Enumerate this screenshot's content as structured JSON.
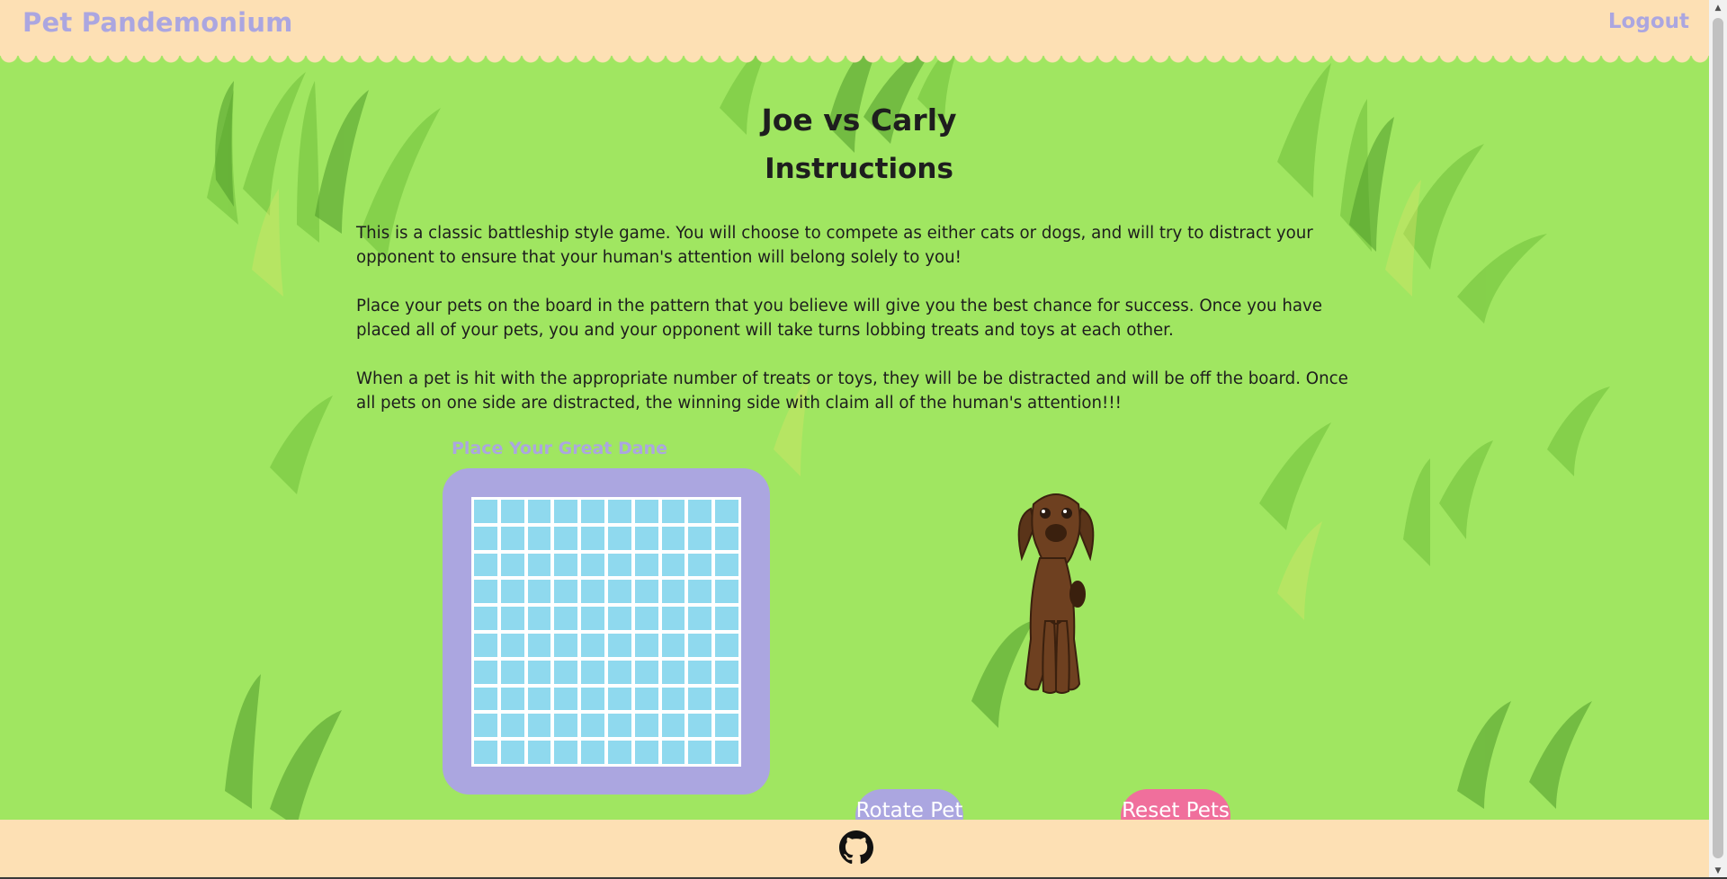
{
  "header": {
    "brand": "Pet Pandemonium",
    "logout": "Logout"
  },
  "game": {
    "match_title": "Joe vs Carly",
    "instructions_title": "Instructions",
    "paragraphs": [
      "This is a classic battleship style game. You will choose to compete as either cats or dogs, and will try to distract your opponent to ensure that your human's attention will belong solely to you!",
      "Place your pets on the board in the pattern that you believe will give you the best chance for success. Once you have placed all of your pets, you and your opponent will take turns lobbing treats and toys at each other.",
      "When a pet is hit with the appropriate number of treats or toys, they will be be distracted and will be off the board. Once all pets on one side are distracted, the winning side with claim all of the human's attention!!!"
    ],
    "place_label": "Place Your Great Dane",
    "board": {
      "rows": 10,
      "cols": 10
    },
    "pet_icon": "great-dane-dog",
    "rotate_button": "Rotate Pet",
    "reset_button": "Reset Pets"
  },
  "footer": {
    "icon": "github-icon"
  },
  "colors": {
    "header_bg": "#fde0b4",
    "brand": "#aba6e0",
    "background": "#a0e661",
    "board_frame": "#aba6e0",
    "cell": "#8fd9ee",
    "rotate_button": "#aba6e0",
    "reset_button": "#f06f9c"
  }
}
